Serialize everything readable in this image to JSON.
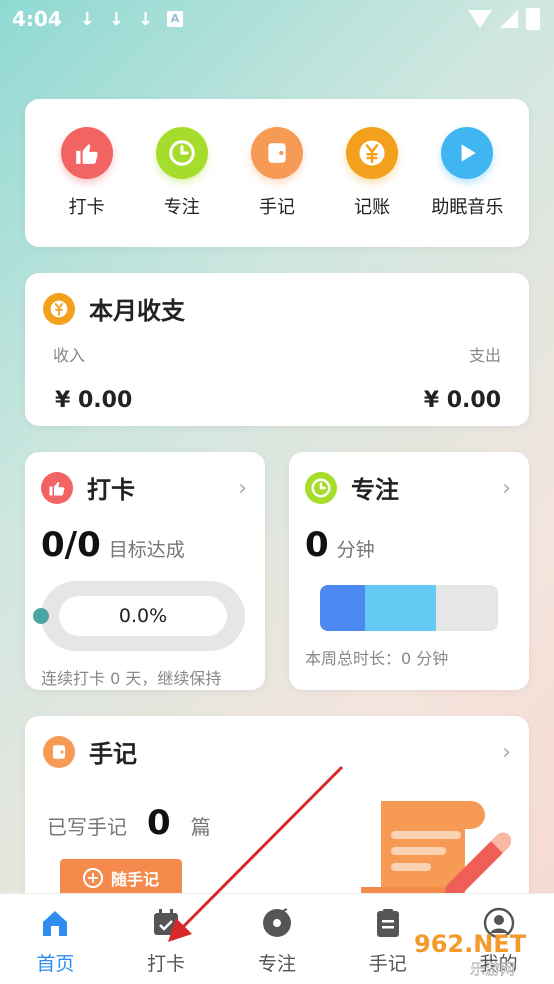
{
  "status_bar": {
    "time": "4:04",
    "download_icon": "↓",
    "a_icon": "A"
  },
  "quick_actions": [
    {
      "label": "打卡",
      "icon": "thumbs-up-icon",
      "color": "#f26464"
    },
    {
      "label": "专注",
      "icon": "clock-icon",
      "color": "#a6dc2c"
    },
    {
      "label": "手记",
      "icon": "notebook-icon",
      "color": "#f79a55"
    },
    {
      "label": "记账",
      "icon": "yen-coin-icon",
      "color": "#f3a11d"
    },
    {
      "label": "助眠音乐",
      "icon": "play-icon",
      "color": "#3fb6f2"
    }
  ],
  "monthly": {
    "title": "本月收支",
    "income_label": "收入",
    "expense_label": "支出",
    "income_value": "¥ 0.00",
    "expense_value": "¥ 0.00"
  },
  "checkin": {
    "title": "打卡",
    "count": "0/0",
    "count_sub": "目标达成",
    "progress_text": "0.0%",
    "progress": 0,
    "footer": "连续打卡 0 天，继续保持"
  },
  "focus": {
    "title": "专注",
    "minutes": "0",
    "minutes_unit": "分钟",
    "footer": "本周总时长：0 分钟"
  },
  "journal": {
    "title": "手记",
    "written_label": "已写手记",
    "written_count": "0",
    "written_unit": "篇",
    "button_label": "随手记",
    "button_plus": "+"
  },
  "tabs": [
    {
      "label": "首页",
      "active": true
    },
    {
      "label": "打卡",
      "active": false
    },
    {
      "label": "专注",
      "active": false
    },
    {
      "label": "手记",
      "active": false
    },
    {
      "label": "我的",
      "active": false
    }
  ],
  "watermark": {
    "main": "962.NET",
    "sub": "乐游网"
  },
  "colors": {
    "accent": "#2f8cf0",
    "annotation_arrow": "#d62a2a"
  }
}
